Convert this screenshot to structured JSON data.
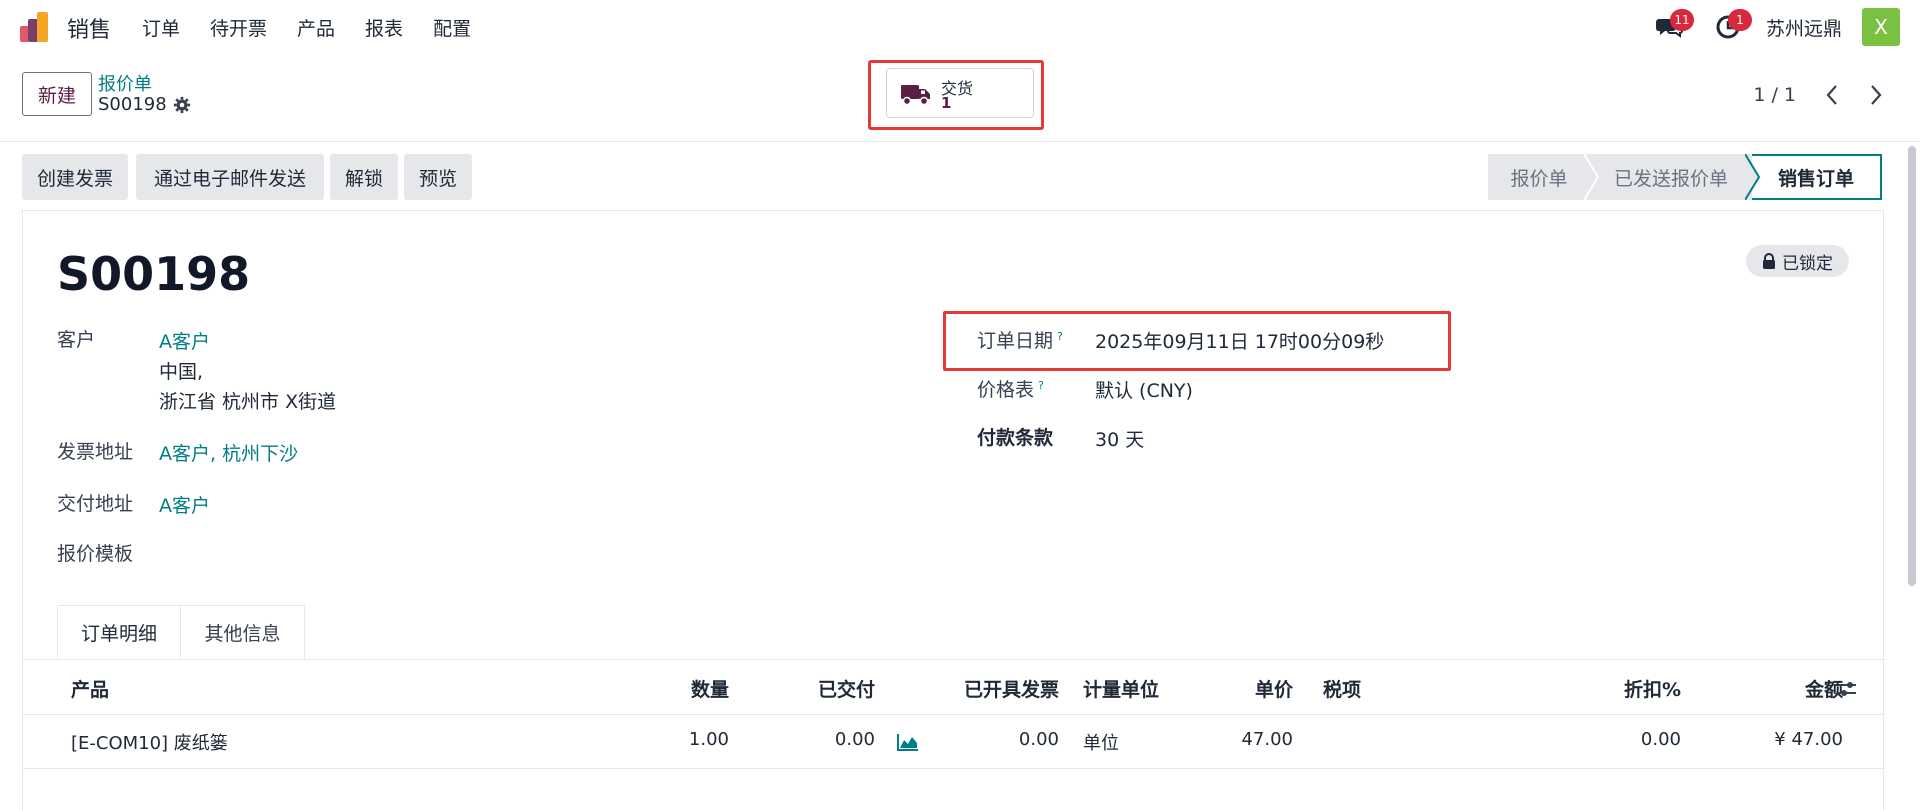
{
  "nav": {
    "app_name": "销售",
    "menu": [
      "订单",
      "待开票",
      "产品",
      "报表",
      "配置"
    ],
    "messages_count": "11",
    "activities_count": "1",
    "company": "苏州远鼎",
    "avatar_letter": "X"
  },
  "control": {
    "new_label": "新建",
    "breadcrumb_parent": "报价单",
    "breadcrumb_current": "S00198",
    "smart_delivery_label": "交货",
    "smart_delivery_count": "1",
    "pager": "1 / 1"
  },
  "actions": [
    "创建发票",
    "通过电子邮件发送",
    "解锁",
    "预览"
  ],
  "status_stages": [
    "报价单",
    "已发送报价单",
    "销售订单"
  ],
  "record": {
    "name": "S00198",
    "locked_label": "已锁定",
    "customer_label": "客户",
    "customer_name": "A客户",
    "customer_addr1": "中国,",
    "customer_addr2": "浙江省 杭州市 X街道",
    "invoice_addr_label": "发票地址",
    "invoice_addr": "A客户, 杭州下沙",
    "delivery_addr_label": "交付地址",
    "delivery_addr": "A客户",
    "template_label": "报价模板",
    "order_date_label": "订单日期",
    "order_date": "2025年09月11日 17时00分09秒",
    "pricelist_label": "价格表",
    "pricelist": "默认 (CNY)",
    "payment_terms_label": "付款条款",
    "payment_terms": "30 天",
    "help_mark": "?"
  },
  "tabs": [
    "订单明细",
    "其他信息"
  ],
  "table": {
    "headers": [
      "产品",
      "数量",
      "已交付",
      "已开具发票",
      "计量单位",
      "单价",
      "税项",
      "折扣%",
      "金额"
    ],
    "rows": [
      {
        "product": "[E-COM10] 废纸篓",
        "qty": "1.00",
        "delivered": "0.00",
        "invoiced": "0.00",
        "uom": "单位",
        "price": "47.00",
        "tax": "",
        "discount": "0.00",
        "amount": "¥ 47.00"
      }
    ]
  },
  "colors": {
    "accent_teal": "#017e84",
    "brand_purple": "#5b1e45",
    "highlight_red": "#e53935",
    "badge_red": "#d9283b",
    "avatar_green": "#7ac142"
  }
}
